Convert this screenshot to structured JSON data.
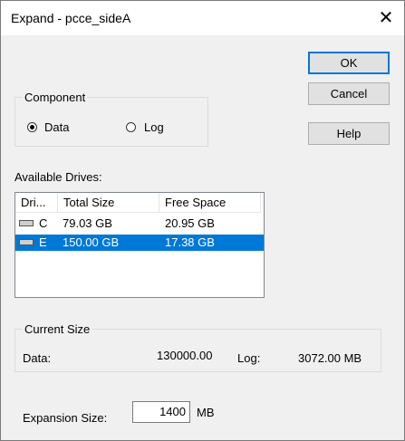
{
  "window": {
    "title": "Expand - pcce_sideA",
    "close_glyph": "✕"
  },
  "buttons": {
    "ok": "OK",
    "cancel": "Cancel",
    "help": "Help"
  },
  "component": {
    "legend": "Component",
    "options": [
      {
        "label": "Data",
        "checked": true
      },
      {
        "label": "Log",
        "checked": false
      }
    ]
  },
  "drives": {
    "label": "Available Drives:",
    "columns": [
      "Dri...",
      "Total Size",
      "Free Space"
    ],
    "rows": [
      {
        "drive": "C",
        "total": "79.03 GB",
        "free": "20.95 GB",
        "selected": false
      },
      {
        "drive": "E",
        "total": "150.00 GB",
        "free": "17.38 GB",
        "selected": true
      }
    ]
  },
  "current_size": {
    "legend": "Current Size",
    "data_label": "Data:",
    "data_value": "130000.00",
    "log_label": "Log:",
    "log_value": "3072.00 MB"
  },
  "expansion": {
    "label": "Expansion Size:",
    "value": "1400",
    "unit": "MB"
  },
  "colors": {
    "selection": "#0078d7",
    "default_button_border": "#0078d7"
  }
}
